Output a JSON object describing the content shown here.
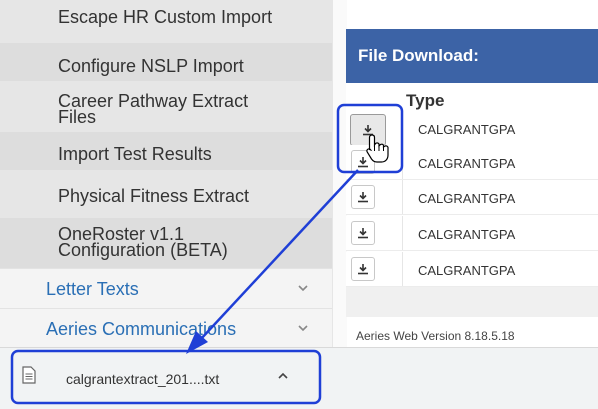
{
  "sidebar": {
    "submenu": [
      {
        "label": "Escape HR Custom Import"
      },
      {
        "label": "Configure NSLP Import"
      },
      {
        "label_line1": "Career Pathway Extract",
        "label_line2": "Files"
      },
      {
        "label": "Import Test Results"
      },
      {
        "label": "Physical Fitness Extract"
      },
      {
        "label_line1": "OneRoster v1.1",
        "label_line2": "Configuration (BETA)"
      }
    ],
    "menu": [
      {
        "label": "Letter Texts"
      },
      {
        "label": "Aeries Communications"
      }
    ]
  },
  "panel": {
    "title": "File Download:",
    "column_type": "Type",
    "rows": [
      {
        "type": "CALGRANTGPA"
      },
      {
        "type": "CALGRANTGPA"
      },
      {
        "type": "CALGRANTGPA"
      },
      {
        "type": "CALGRANTGPA"
      },
      {
        "type": "CALGRANTGPA"
      }
    ],
    "version": "Aeries Web Version 8.18.5.18"
  },
  "download_bar": {
    "filename": "calgrantextract_201....txt"
  },
  "colors": {
    "header_blue": "#3c63a6",
    "annotation_blue": "#1f3fd6",
    "link_blue": "#2a6fb5"
  },
  "icons": [
    "download-icon",
    "chevron-down-icon",
    "file-icon",
    "caret-up-icon",
    "hand-cursor-icon"
  ]
}
